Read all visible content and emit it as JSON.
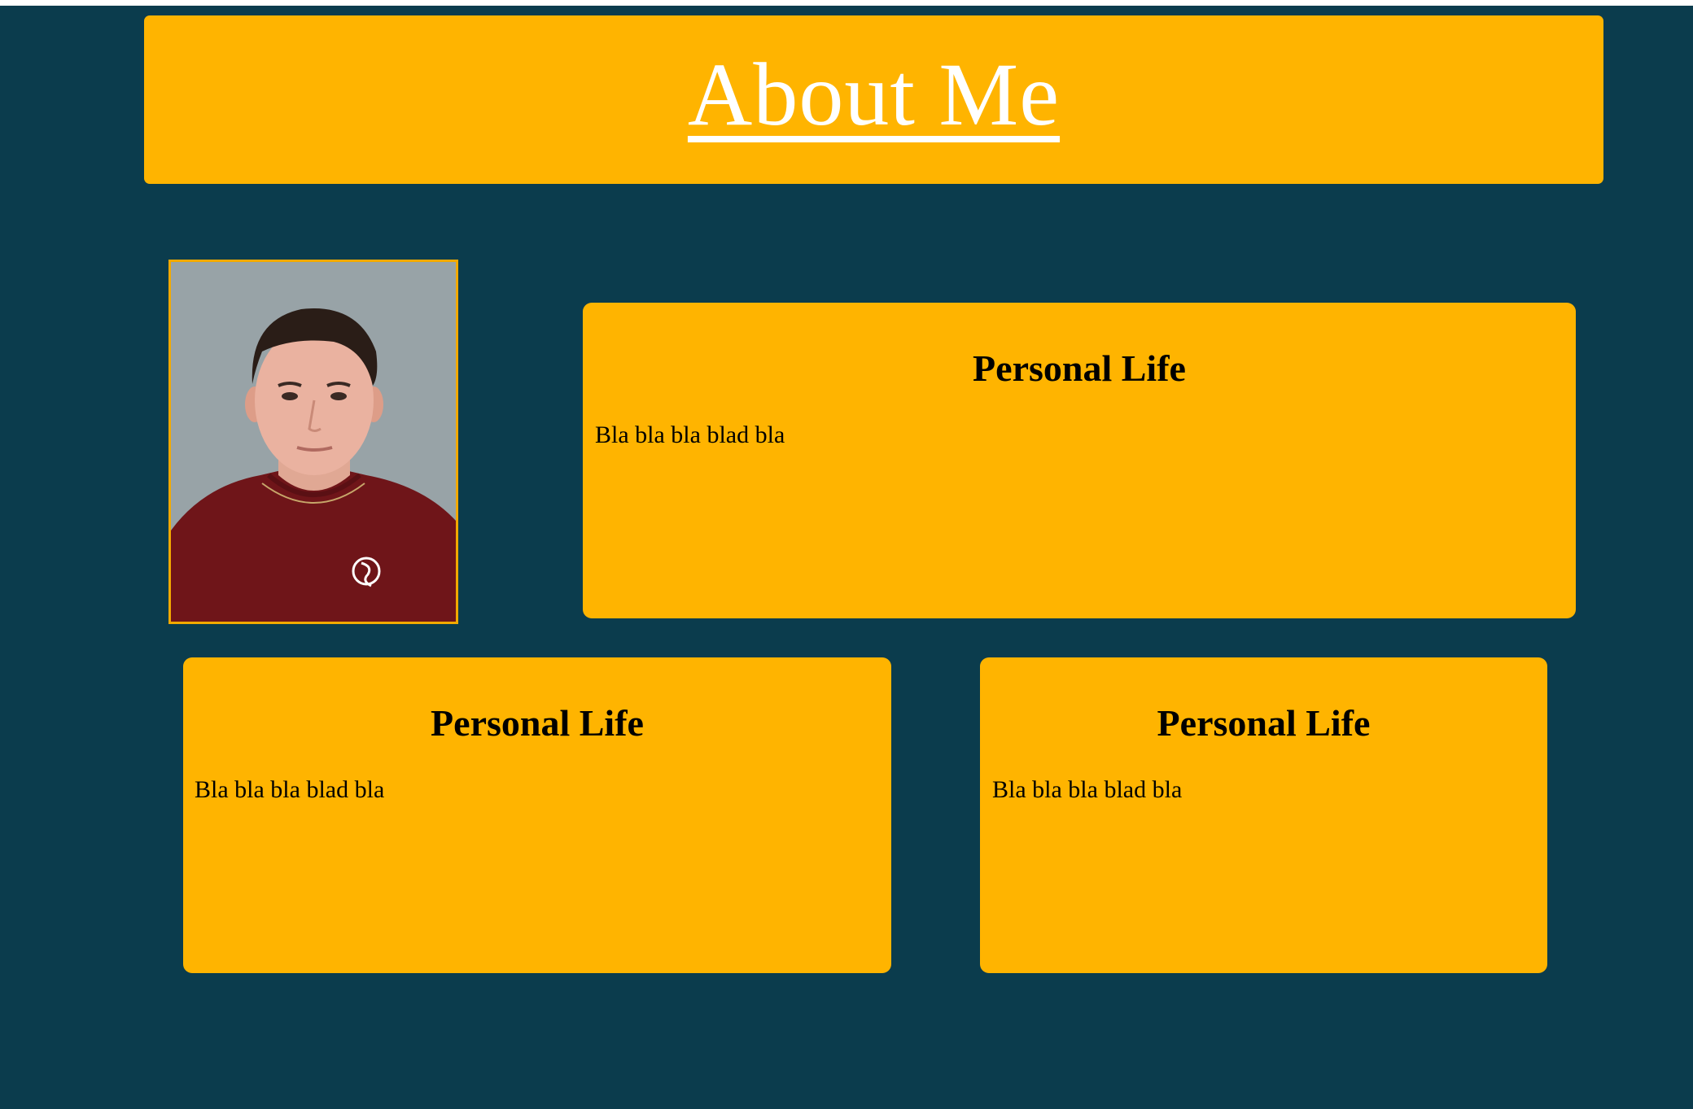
{
  "header": {
    "title": "About Me"
  },
  "photo": {
    "alt": "profile-photo"
  },
  "sections": [
    {
      "title": "Personal Life",
      "body": "Bla bla bla blad bla"
    },
    {
      "title": "Personal Life",
      "body": "Bla bla bla blad bla"
    },
    {
      "title": "Personal Life",
      "body": "Bla bla bla blad bla"
    }
  ],
  "colors": {
    "background": "#0b3c4d",
    "card": "#ffb400",
    "title_text": "#ffffff",
    "body_text": "#000000"
  }
}
